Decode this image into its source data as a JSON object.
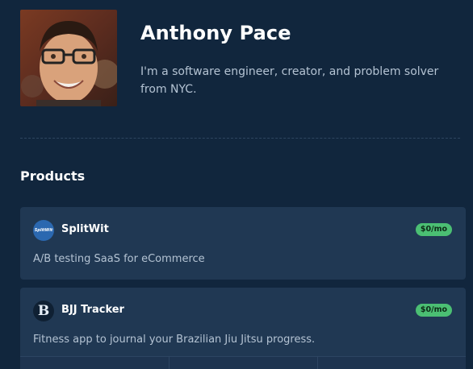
{
  "profile": {
    "name": "Anthony Pace",
    "bio": "I'm a software engineer, creator, and problem solver from NYC."
  },
  "products_section": {
    "title": "Products",
    "items": [
      {
        "name": "SplitWit",
        "logo_text": "SplitWit",
        "logo_icon": "splitwit-logo",
        "price": "$0/mo",
        "description": "A/B testing SaaS for eCommerce"
      },
      {
        "name": "BJJ Tracker",
        "logo_text": "B",
        "logo_icon": "bjj-tracker-logo",
        "price": "$0/mo",
        "description": "Fitness app to journal your Brazilian Jiu Jitsu progress."
      }
    ]
  },
  "colors": {
    "background": "#11263d",
    "card": "#203853",
    "price_badge": "#4bbf73"
  }
}
